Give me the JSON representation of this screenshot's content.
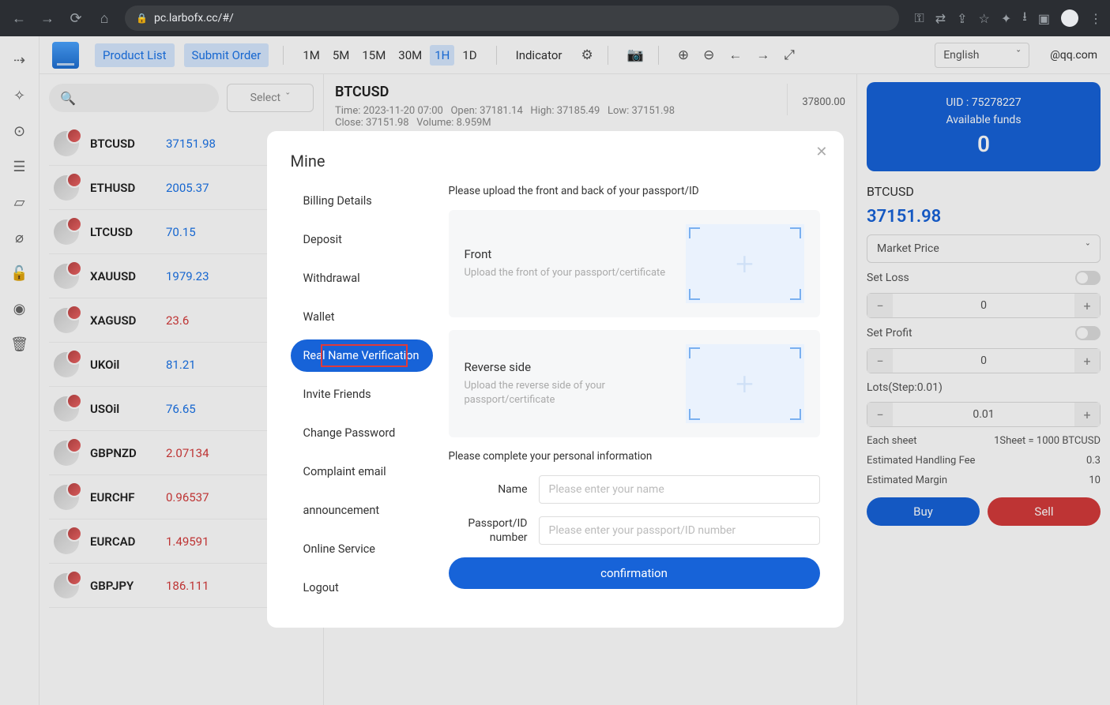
{
  "browser": {
    "url": "pc.larbofx.cc/#/"
  },
  "topbar": {
    "product_list": "Product List",
    "submit_order": "Submit Order",
    "timeframes": [
      "1M",
      "5M",
      "15M",
      "30M",
      "1H",
      "1D"
    ],
    "active_tf": "1H",
    "indicator": "Indicator",
    "language": "English",
    "user_email": "@qq.com"
  },
  "search": {
    "select_label": "Select"
  },
  "symbols": [
    {
      "name": "BTCUSD",
      "price": "37151.98",
      "cls": "blue"
    },
    {
      "name": "ETHUSD",
      "price": "2005.37",
      "cls": "blue"
    },
    {
      "name": "LTCUSD",
      "price": "70.15",
      "cls": "blue"
    },
    {
      "name": "XAUUSD",
      "price": "1979.23",
      "cls": "blue"
    },
    {
      "name": "XAGUSD",
      "price": "23.6",
      "cls": "red"
    },
    {
      "name": "UKOil",
      "price": "81.21",
      "cls": "blue"
    },
    {
      "name": "USOil",
      "price": "76.65",
      "cls": "blue"
    },
    {
      "name": "GBPNZD",
      "price": "2.07134",
      "cls": "red"
    },
    {
      "name": "EURCHF",
      "price": "0.96537",
      "cls": "red"
    },
    {
      "name": "EURCAD",
      "price": "1.49591",
      "cls": "red"
    },
    {
      "name": "GBPJPY",
      "price": "186.111",
      "cls": "red"
    }
  ],
  "chart": {
    "title": "BTCUSD",
    "meta1": "Time: 2023-11-20 07:00   Open: 37181.14   High: 37185.49   Low: 37151.98",
    "meta2": "Close: 37151.98   Volume: 8.959M",
    "axis_val": "37800.00"
  },
  "account": {
    "uid_label": "UID : 75278227",
    "funds_label": "Available funds",
    "funds_value": "0"
  },
  "order": {
    "pair": "BTCUSD",
    "price": "37151.98",
    "price_type": "Market Price",
    "set_loss": "Set Loss",
    "loss_val": "0",
    "set_profit": "Set Profit",
    "profit_val": "0",
    "lots_label": "Lots(Step:0.01)",
    "lots_val": "0.01",
    "each_sheet_l": "Each sheet",
    "each_sheet_v": "1Sheet = 1000 BTCUSD",
    "fee_l": "Estimated Handling Fee",
    "fee_v": "0.3",
    "margin_l": "Estimated Margin",
    "margin_v": "10",
    "buy": "Buy",
    "sell": "Sell"
  },
  "modal": {
    "title": "Mine",
    "nav": [
      "Billing Details",
      "Deposit",
      "Withdrawal",
      "Wallet",
      "Real Name Verification",
      "Invite Friends",
      "Change Password",
      "Complaint email",
      "announcement",
      "Online Service",
      "Logout"
    ],
    "active_nav": "Real Name Verification",
    "upload_hint": "Please upload the front and back of your passport/ID",
    "front": {
      "title": "Front",
      "sub": "Upload the front of your passport/certificate"
    },
    "back": {
      "title": "Reverse side",
      "sub": "Upload the reverse side of your passport/certificate"
    },
    "info_hint": "Please complete your personal information",
    "name_label": "Name",
    "name_ph": "Please enter your name",
    "id_label": "Passport/ID number",
    "id_ph": "Please enter your passport/ID number",
    "confirm": "confirmation"
  }
}
